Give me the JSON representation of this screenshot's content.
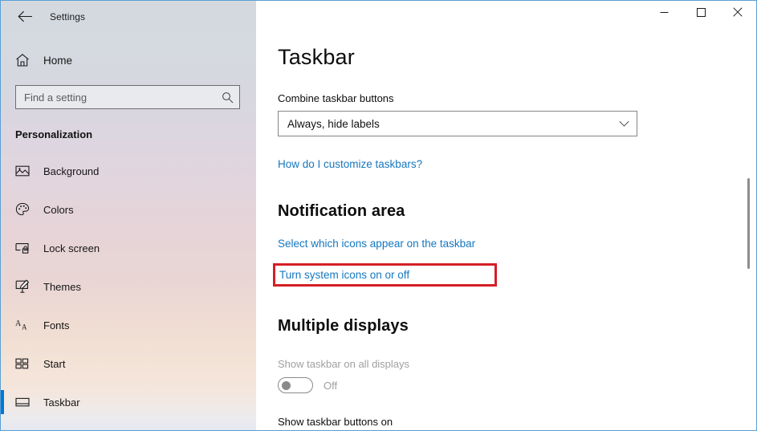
{
  "window": {
    "title": "Settings",
    "back_icon": "back-arrow-icon",
    "minimize_label": "─",
    "maximize_label": "☐",
    "close_label": "✕",
    "accent_color": "#0078d4",
    "border_color": "#5a9fd4"
  },
  "sidebar": {
    "home_label": "Home",
    "home_icon": "home-icon",
    "search": {
      "placeholder": "Find a setting",
      "value": "",
      "icon": "search-icon"
    },
    "category": "Personalization",
    "items": [
      {
        "label": "Background",
        "icon": "image-icon",
        "selected": false
      },
      {
        "label": "Colors",
        "icon": "palette-icon",
        "selected": false
      },
      {
        "label": "Lock screen",
        "icon": "lock-screen-icon",
        "selected": false
      },
      {
        "label": "Themes",
        "icon": "brush-icon",
        "selected": false
      },
      {
        "label": "Fonts",
        "icon": "font-icon",
        "selected": false
      },
      {
        "label": "Start",
        "icon": "start-tiles-icon",
        "selected": false
      },
      {
        "label": "Taskbar",
        "icon": "taskbar-icon",
        "selected": true
      }
    ]
  },
  "main": {
    "page_title": "Taskbar",
    "combine_label": "Combine taskbar buttons",
    "combine_value": "Always, hide labels",
    "combine_chevron_icon": "chevron-down-icon",
    "customize_link": "How do I customize taskbars?",
    "notification_heading": "Notification area",
    "select_icons_link": "Select which icons appear on the taskbar",
    "system_icons_link": "Turn system icons on or off",
    "highlight_color": "#d41f26",
    "multiple_displays_heading": "Multiple displays",
    "show_taskbar_all_label": "Show taskbar on all displays",
    "show_taskbar_all_state": "Off",
    "show_taskbar_buttons_label": "Show taskbar buttons on"
  }
}
